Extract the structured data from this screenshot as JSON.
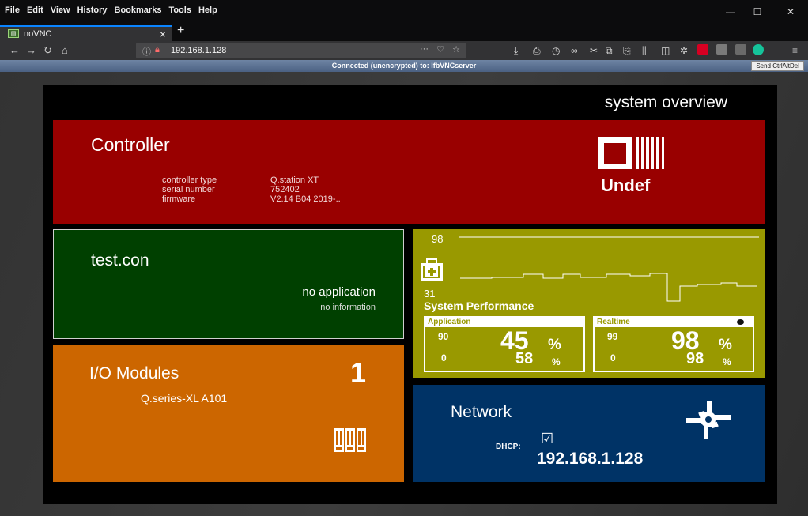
{
  "browser": {
    "menu": [
      "File",
      "Edit",
      "View",
      "History",
      "Bookmarks",
      "Tools",
      "Help"
    ],
    "menu_mnemonics": [
      "F",
      "E",
      "V",
      "s",
      "B",
      "T",
      "H"
    ],
    "tab_title": "noVNC",
    "url": "192.168.1.128",
    "win_minimize": "—",
    "win_maximize": "☐",
    "win_close": "✕"
  },
  "vnc": {
    "status": "Connected (unencrypted) to: lfbVNCserver",
    "send_ctrl_alt_del": "Send CtrlAltDel"
  },
  "dashboard": {
    "title": "system overview",
    "controller": {
      "heading": "Controller",
      "fields": [
        {
          "label": "controller type",
          "value": "Q.station XT"
        },
        {
          "label": "serial number",
          "value": "752402"
        },
        {
          "label": "firmware",
          "value": "V2.14 B04 2019-.."
        }
      ],
      "status": "Undef"
    },
    "application": {
      "heading": "test.con",
      "status": "no application",
      "info": "no information"
    },
    "io_modules": {
      "heading": "I/O Modules",
      "count": "1",
      "module": "Q.series-XL A101"
    },
    "performance": {
      "title": "System Performance",
      "axis_max": "98",
      "axis_min": "31",
      "application": {
        "label": "Application",
        "max": "90",
        "min": "0",
        "current": "45",
        "average": "58",
        "unit": "%"
      },
      "realtime": {
        "label": "Realtime",
        "max": "99",
        "min": "0",
        "current": "98",
        "average": "98",
        "unit": "%"
      }
    },
    "network": {
      "heading": "Network",
      "dhcp_label": "DHCP:",
      "dhcp_enabled": true,
      "ip": "192.168.1.128"
    }
  },
  "colors": {
    "controller": "#990000",
    "application": "#004000",
    "io_modules": "#cc6600",
    "performance": "#999900",
    "network": "#003366"
  }
}
